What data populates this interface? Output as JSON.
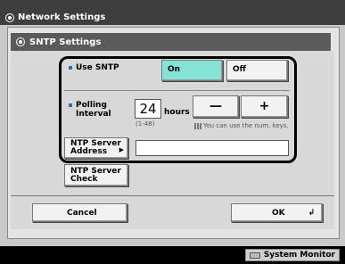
{
  "window": {
    "title": "Network Settings"
  },
  "dialog": {
    "title": "SNTP Settings"
  },
  "sntp": {
    "use_label": "Use SNTP",
    "on_label": "On",
    "off_label": "Off",
    "selected": "On"
  },
  "polling": {
    "label_line1": "Polling",
    "label_line2": "Interval",
    "value": "24",
    "unit": "hours",
    "range": "(1-48)",
    "minus_label": "—",
    "plus_label": "+",
    "hint": "You can use the num. keys."
  },
  "ntp": {
    "address_line1": "NTP Server",
    "address_line2": "Address",
    "address_value": "",
    "check_line1": "NTP Server",
    "check_line2": "Check"
  },
  "footer": {
    "cancel_label": "Cancel",
    "ok_label": "OK",
    "system_monitor_label": "System Monitor"
  }
}
